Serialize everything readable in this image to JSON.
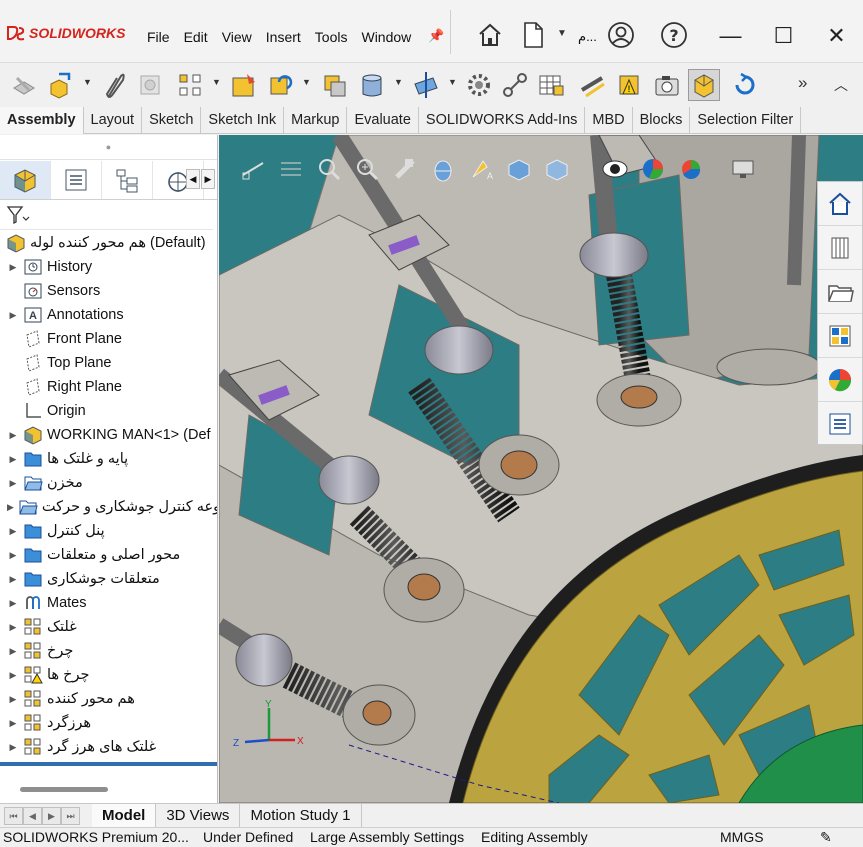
{
  "app": {
    "name": "SOLIDWORKS",
    "file_name": "م..."
  },
  "menu": [
    "File",
    "Edit",
    "View",
    "Insert",
    "Tools",
    "Window"
  ],
  "command_tabs": [
    {
      "label": "Assembly",
      "active": true
    },
    {
      "label": "Layout"
    },
    {
      "label": "Sketch"
    },
    {
      "label": "Sketch Ink"
    },
    {
      "label": "Markup"
    },
    {
      "label": "Evaluate"
    },
    {
      "label": "SOLIDWORKS Add-Ins"
    },
    {
      "label": "MBD"
    },
    {
      "label": "Blocks"
    },
    {
      "label": "Selection Filter"
    }
  ],
  "tree": {
    "root": "هم محور کننده لوله (Default)",
    "items": [
      {
        "label": "History",
        "icon": "history-icon",
        "expand": true
      },
      {
        "label": "Sensors",
        "icon": "sensors-icon",
        "expand": false
      },
      {
        "label": "Annotations",
        "icon": "annotations-icon",
        "expand": true
      },
      {
        "label": "Front Plane",
        "icon": "plane-icon",
        "expand": false
      },
      {
        "label": "Top Plane",
        "icon": "plane-icon",
        "expand": false
      },
      {
        "label": "Right Plane",
        "icon": "plane-icon",
        "expand": false
      },
      {
        "label": "Origin",
        "icon": "origin-icon",
        "expand": false
      },
      {
        "label": "WORKING MAN<1> (Def",
        "icon": "part-icon",
        "expand": true
      },
      {
        "label": "پایه و غلتک ها",
        "icon": "folder-icon",
        "expand": true
      },
      {
        "label": "مخزن",
        "icon": "folder-open-icon",
        "expand": true
      },
      {
        "label": "مجموعه کنترل جوشکاری و حرکت",
        "icon": "folder-open-icon",
        "expand": true
      },
      {
        "label": "پنل کنترل",
        "icon": "folder-icon",
        "expand": true
      },
      {
        "label": "محور اصلی و متعلقات",
        "icon": "folder-icon",
        "expand": true
      },
      {
        "label": "متعلقات جوشکاری",
        "icon": "folder-icon",
        "expand": true
      },
      {
        "label": "Mates",
        "icon": "mates-icon",
        "expand": true
      },
      {
        "label": "غلتک",
        "icon": "assembly-icon",
        "expand": true
      },
      {
        "label": "چرخ",
        "icon": "assembly-icon",
        "expand": true
      },
      {
        "label": "چرخ ها",
        "icon": "assembly-warn-icon",
        "expand": true
      },
      {
        "label": "هم محور کننده",
        "icon": "assembly-icon",
        "expand": true
      },
      {
        "label": "هرزگرد",
        "icon": "assembly-icon",
        "expand": true
      },
      {
        "label": "غلتک های هرز گرد",
        "icon": "assembly-icon",
        "expand": true
      }
    ]
  },
  "bottom_tabs": [
    {
      "label": "Model",
      "active": true
    },
    {
      "label": "3D Views"
    },
    {
      "label": "Motion Study 1"
    }
  ],
  "status": {
    "product": "SOLIDWORKS Premium 20...",
    "state": "Under Defined",
    "settings": "Large Assembly Settings",
    "mode": "Editing Assembly",
    "units": "MMGS"
  },
  "triad_labels": {
    "x": "X",
    "y": "Y",
    "z": "Z"
  }
}
